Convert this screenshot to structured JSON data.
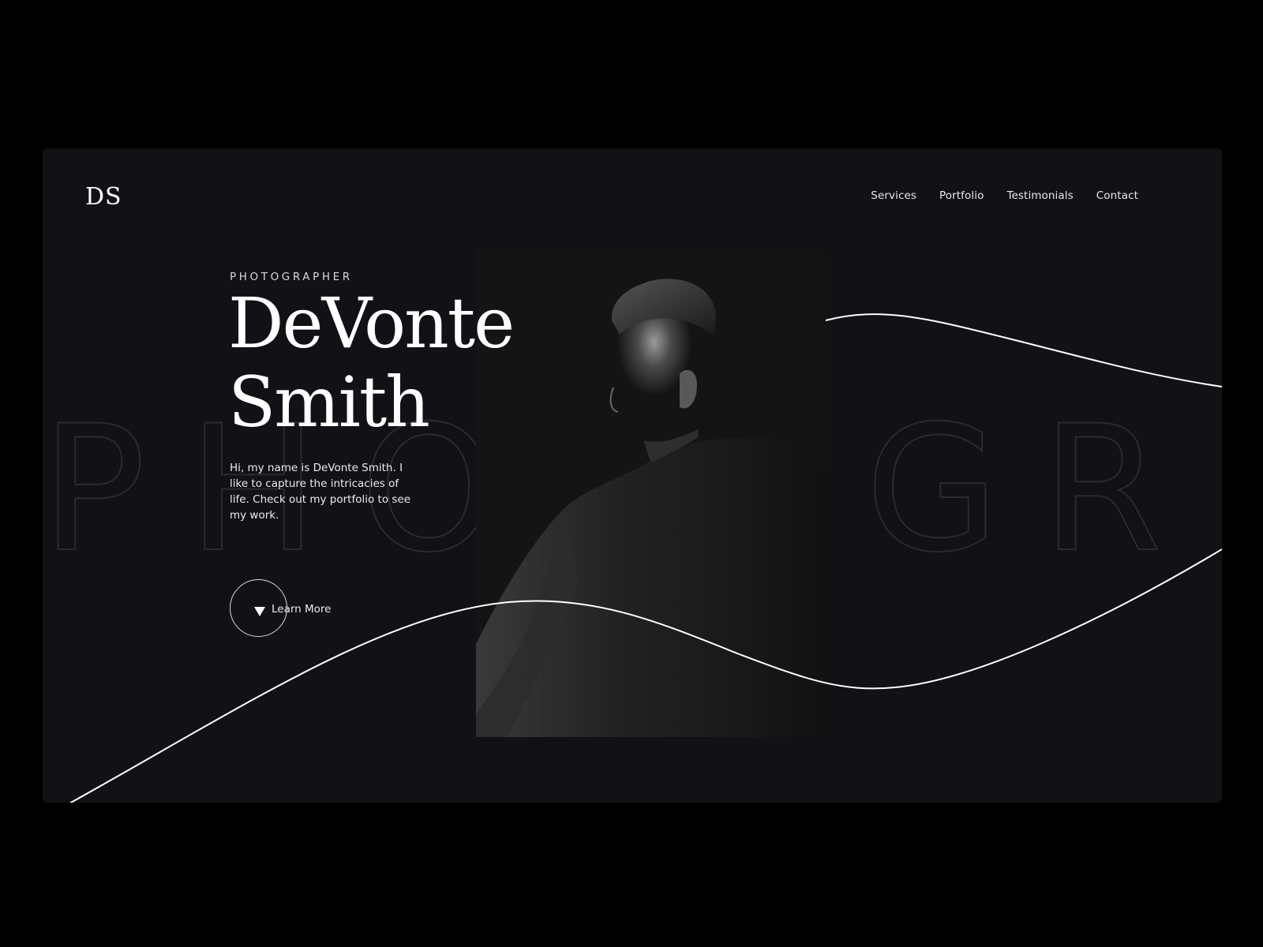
{
  "site": {
    "logo_text": "DS"
  },
  "nav": {
    "items": [
      {
        "label": "Services"
      },
      {
        "label": "Portfolio"
      },
      {
        "label": "Testimonials"
      },
      {
        "label": "Contact"
      }
    ]
  },
  "hero": {
    "eyebrow": "PHOTOGRAPHER",
    "name_line1": "DeVonte",
    "name_line2": "Smith",
    "intro": "Hi, my name is DeVonte Smith. I like to capture the intricacies of life. Check out my portfolio to see my work.",
    "cta_label": "Learn More",
    "background_word": "PHOTOGR"
  },
  "colors": {
    "page_background": "#000000",
    "card_background": "#111116",
    "text_primary": "#ffffff",
    "wave_stroke": "#ffffff",
    "outline_text": "#2a2a30"
  },
  "icons": {
    "cta_icon": "triangle-down-icon"
  }
}
